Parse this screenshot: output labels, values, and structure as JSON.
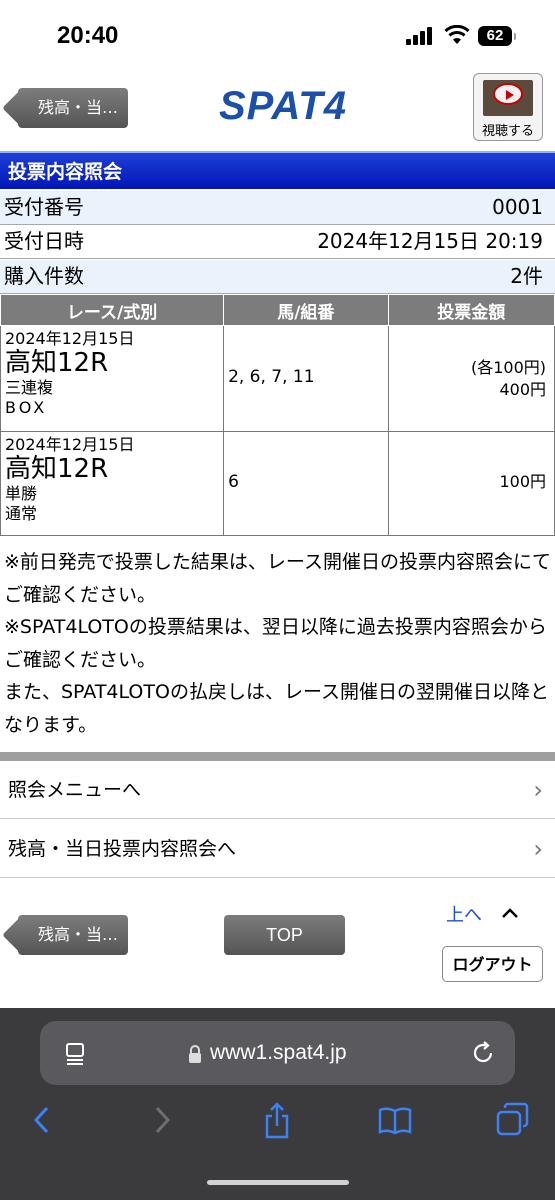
{
  "status_bar": {
    "time": "20:40",
    "battery": "62"
  },
  "header": {
    "back_label": "残高・当…",
    "logo": "SPAT4",
    "video_label": "視聴する"
  },
  "page_title": "投票内容照会",
  "info": [
    {
      "label": "受付番号",
      "value": "0001"
    },
    {
      "label": "受付日時",
      "value": "2024年12月15日 20:19"
    },
    {
      "label": "購入件数",
      "value": "2件"
    }
  ],
  "table": {
    "headers": [
      "レース/式別",
      "馬/組番",
      "投票金額"
    ],
    "rows": [
      {
        "date": "2024年12月15日",
        "race": "高知12R",
        "type": "三連複",
        "method": "BOX",
        "horses": "2, 6, 7, 11",
        "amount_each": "(各100円)",
        "amount": "400円"
      },
      {
        "date": "2024年12月15日",
        "race": "高知12R",
        "type": "単勝",
        "method": "通常",
        "horses": "6",
        "amount_each": "",
        "amount": "100円"
      }
    ]
  },
  "notes": [
    "※前日発売で投票した結果は、レース開催日の投票内容照会にてご確認ください。",
    "※SPAT4LOTOの投票結果は、翌日以降に過去投票内容照会からご確認ください。",
    "また、SPAT4LOTOの払戻しは、レース開催日の翌開催日以降となります。"
  ],
  "menu": [
    {
      "label": "照会メニューへ"
    },
    {
      "label": "残高・当日投票内容照会へ"
    }
  ],
  "footer": {
    "back_label": "残高・当…",
    "top_label": "TOP",
    "up_label": "上へ",
    "logout_label": "ログアウト"
  },
  "browser": {
    "url": "www1.spat4.jp"
  },
  "colors": {
    "title_bar": "#0a23c8",
    "row_tint": "#eaf2fb",
    "header_gray": "#7c7c7c",
    "link": "#1a4fd6"
  }
}
